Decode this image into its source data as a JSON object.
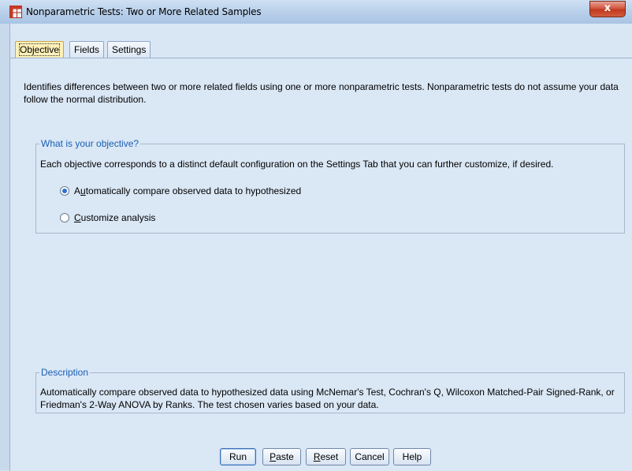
{
  "window": {
    "title": "Nonparametric Tests: Two or More Related Samples",
    "close_symbol": "x"
  },
  "tabs": [
    {
      "label": "Objective",
      "active": true
    },
    {
      "label": "Fields",
      "active": false
    },
    {
      "label": "Settings",
      "active": false
    }
  ],
  "intro_text": "Identifies differences between two or more related fields using one or more nonparametric tests. Nonparametric tests do not assume your data follow the normal distribution.",
  "objective_group": {
    "legend": "What is your objective?",
    "description": "Each objective corresponds to a distinct default configuration on the Settings Tab that you can further customize, if desired.",
    "options": [
      {
        "label_pre": "A",
        "label_mnemonic": "u",
        "label_post": "tomatically compare observed data to hypothesized",
        "checked": true
      },
      {
        "label_pre": "",
        "label_mnemonic": "C",
        "label_post": "ustomize analysis",
        "checked": false
      }
    ]
  },
  "description_group": {
    "legend": "Description",
    "text": "Automatically compare observed data to hypothesized data using McNemar's Test, Cochran's Q, Wilcoxon Matched-Pair Signed-Rank, or Friedman's 2-Way ANOVA by Ranks.  The test chosen varies based on your data."
  },
  "buttons": {
    "run": "Run",
    "paste_m": "P",
    "paste_rest": "aste",
    "reset_m": "R",
    "reset_rest": "eset",
    "cancel": "Cancel",
    "help": "Help"
  },
  "colors": {
    "legend_text": "#1a5fb4",
    "active_tab": "#fdf0b8",
    "panel_bg": "#dae7f5"
  }
}
